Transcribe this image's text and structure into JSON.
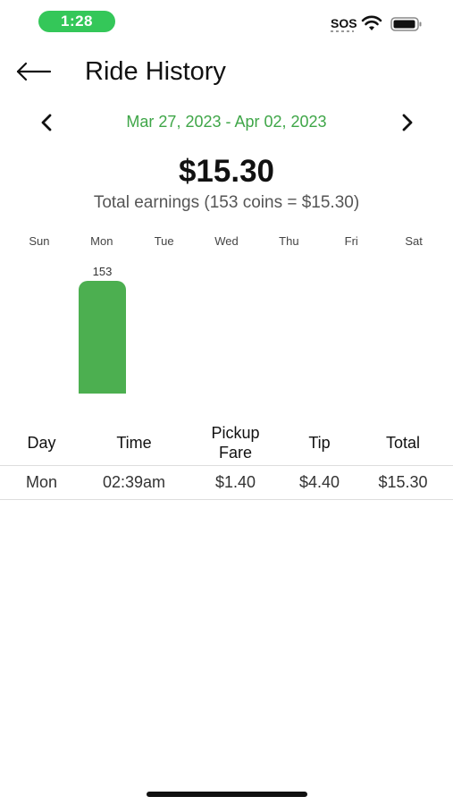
{
  "status_bar": {
    "time": "1:28",
    "sos": "SOS"
  },
  "header": {
    "title": "Ride History"
  },
  "date_range": {
    "label": "Mar 27, 2023 - Apr 02, 2023"
  },
  "summary": {
    "total": "$15.30",
    "subtitle": "Total earnings (153 coins = $15.30)"
  },
  "colors": {
    "accent": "#3fa648",
    "bar": "#4caf50",
    "status_pill": "#34c759"
  },
  "chart_data": {
    "type": "bar",
    "categories": [
      "Sun",
      "Mon",
      "Tue",
      "Wed",
      "Thu",
      "Fri",
      "Sat"
    ],
    "values": [
      0,
      153,
      0,
      0,
      0,
      0,
      0
    ],
    "data_labels": [
      "",
      "153",
      "",
      "",
      "",
      "",
      ""
    ]
  },
  "table": {
    "headers": [
      "Day",
      "Time",
      "Pickup Fare",
      "Tip",
      "Total"
    ],
    "rows": [
      [
        "Mon",
        "02:39am",
        "$1.40",
        "$4.40",
        "$15.30"
      ]
    ]
  }
}
